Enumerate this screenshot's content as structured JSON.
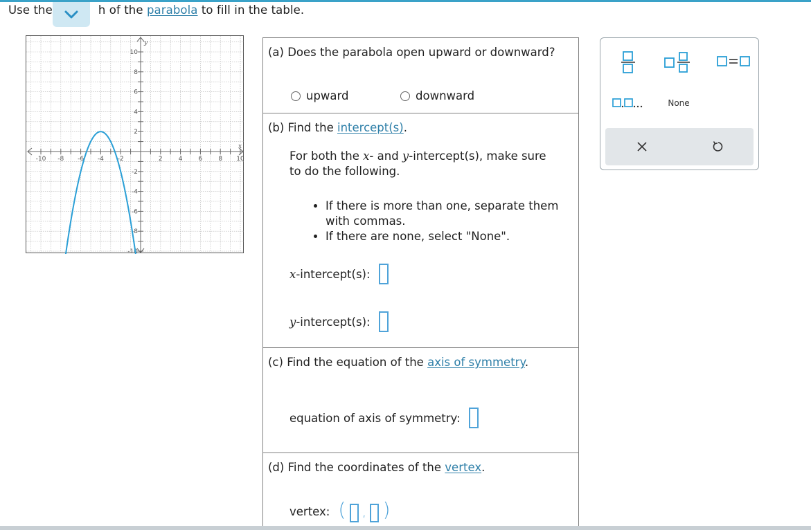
{
  "instruction": {
    "before": "Use the",
    "middle": "h of the",
    "link": "parabola",
    "after": "to fill in the table."
  },
  "graph": {
    "x_ticks": [
      "-10",
      "-8",
      "-6",
      "-4",
      "-2",
      "2",
      "4",
      "6",
      "8",
      "10"
    ],
    "y_ticks": [
      "10",
      "8",
      "6",
      "4",
      "2",
      "-2",
      "-4",
      "-6",
      "-8",
      "-10"
    ],
    "x_axis_label": "x",
    "y_axis_label": "y",
    "curve_color": "#2a9fd6"
  },
  "part_a": {
    "question": "(a) Does the parabola open upward or downward?",
    "options": [
      "upward",
      "downward"
    ]
  },
  "part_b": {
    "prefix": "(b) Find the",
    "link": "intercept(s)",
    "suffix": ".",
    "instr_1": "For both the",
    "x_var": "x",
    "instr_2": "- and",
    "y_var": "y",
    "instr_3": "-intercept(s), make sure",
    "instr_4": "to do the following.",
    "rules": [
      "If there is more than one, separate them with commas.",
      "If there are none, select \"None\"."
    ],
    "x_label": "-intercept(s):",
    "y_label": "-intercept(s):"
  },
  "part_c": {
    "prefix": "(c) Find the equation of the",
    "link": "axis of symmetry",
    "suffix": ".",
    "field_label": "equation of axis of symmetry:"
  },
  "part_d": {
    "prefix": "(d) Find the coordinates of the",
    "link": "vertex",
    "suffix": ".",
    "field_label": "vertex:",
    "open_paren": "(",
    "comma": ",",
    "close_paren": ")"
  },
  "palette": {
    "list_label": "□,□,...",
    "none_label": "None",
    "accent": "#2a9fd6"
  }
}
